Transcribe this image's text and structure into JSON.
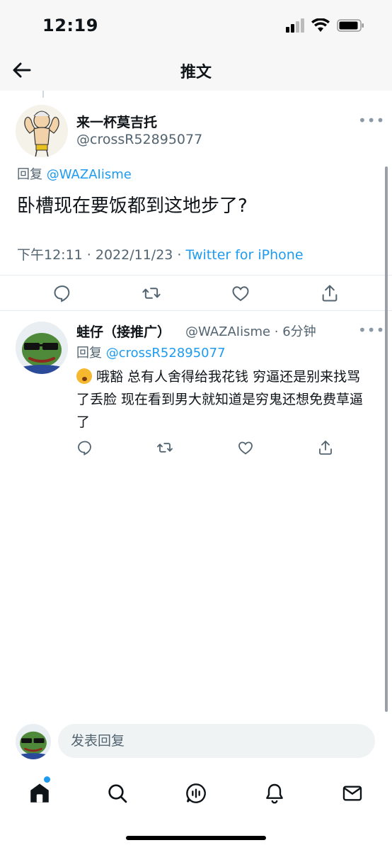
{
  "status": {
    "time": "12:19"
  },
  "nav": {
    "title": "推文"
  },
  "tweet": {
    "name": "来一杯莫吉托",
    "handle": "@crossR52895077",
    "reply_prefix": "回复",
    "reply_to": "@WAZAIisme",
    "text": "卧槽现在要饭都到这地步了?",
    "time": "下午12:11 · 2022/11/23 · ",
    "source": "Twitter for iPhone"
  },
  "reply": {
    "name": "蛙仔（接推广）",
    "handle": "@WAZAIisme · 6分钟",
    "reply_prefix": "回复",
    "reply_to": "@crossR52895077",
    "text": "哦豁 总有人舍得给我花钱 穷逼还是别来找骂了丢脸 现在看到男大就知道是穷鬼还想免费草逼了"
  },
  "compose": {
    "placeholder": "发表回复"
  },
  "icons": [
    "back-arrow-icon",
    "reply-icon",
    "retweet-icon",
    "like-icon",
    "share-icon",
    "home-icon",
    "search-icon",
    "spaces-icon",
    "notifications-icon",
    "messages-icon"
  ],
  "colors": {
    "accent": "#1d9bf0",
    "secondary_text": "#536471"
  }
}
